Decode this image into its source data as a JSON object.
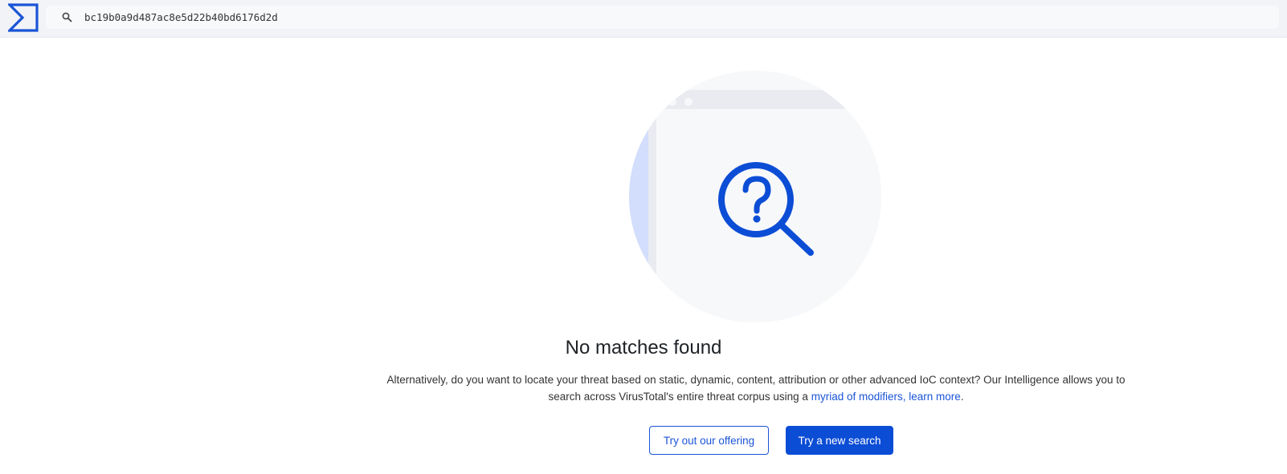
{
  "header": {
    "logo_icon": "virustotal-sigma-logo",
    "search": {
      "icon": "search-icon",
      "value": "bc19b0a9d487ac8e5d22b40bd6176d2d"
    }
  },
  "main": {
    "illustration_icon": "question-magnifier-icon",
    "title": "No matches found",
    "description_before": "Alternatively, do you want to locate your threat based on static, dynamic, content, attribution or other advanced IoC context? Our Intelligence allows you to search across VirusTotal's entire threat corpus using a ",
    "description_link": "myriad of modifiers, learn more",
    "description_after": ".",
    "buttons": {
      "secondary": "Try out our offering",
      "primary": "Try a new search"
    }
  },
  "colors": {
    "accent": "#0c4dd6",
    "topbar_bg": "#f1f3f7",
    "illustration_circle": "#f7f8fa",
    "illustration_blue": "#d3defc"
  }
}
